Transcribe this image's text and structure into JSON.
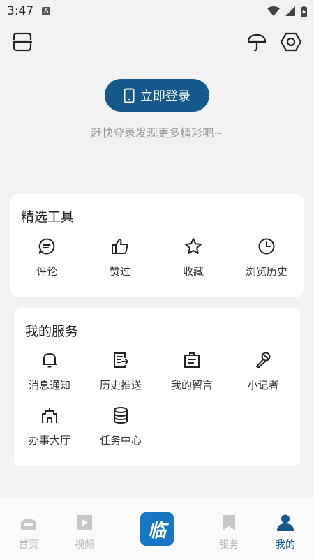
{
  "status_bar": {
    "time": "3:47",
    "badge": "A"
  },
  "login": {
    "button_label": "立即登录",
    "hint": "赶快登录发现更多精彩吧~"
  },
  "tools": {
    "title": "精选工具",
    "items": [
      {
        "label": "评论",
        "icon": "comment-icon"
      },
      {
        "label": "赞过",
        "icon": "thumbs-up-icon"
      },
      {
        "label": "收藏",
        "icon": "star-icon"
      },
      {
        "label": "浏览历史",
        "icon": "clock-icon"
      }
    ]
  },
  "services": {
    "title": "我的服务",
    "items": [
      {
        "label": "消息通知",
        "icon": "bell-icon"
      },
      {
        "label": "历史推送",
        "icon": "push-history-icon"
      },
      {
        "label": "我的留言",
        "icon": "message-board-icon"
      },
      {
        "label": "小记者",
        "icon": "microphone-icon"
      },
      {
        "label": "办事大厅",
        "icon": "hall-icon"
      },
      {
        "label": "任务中心",
        "icon": "database-icon"
      }
    ]
  },
  "tabbar": {
    "tabs": [
      {
        "label": "首页",
        "icon": "home-icon"
      },
      {
        "label": "视频",
        "icon": "play-icon"
      },
      {
        "label": "服务",
        "icon": "bookmark-icon"
      },
      {
        "label": "我的",
        "icon": "person-icon",
        "active": true
      }
    ],
    "center_logo_text": "临"
  },
  "colors": {
    "accent": "#14588c",
    "center_logo": "#1877c5",
    "background": "#f2f2f2",
    "muted": "#999999"
  }
}
